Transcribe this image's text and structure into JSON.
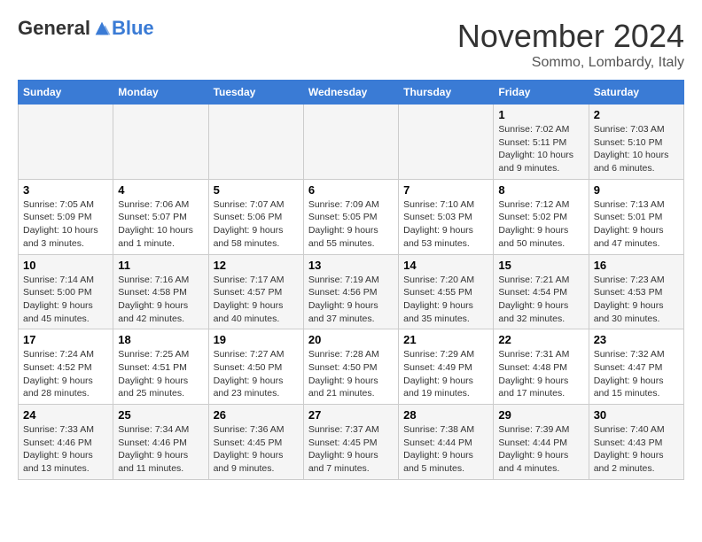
{
  "header": {
    "logo_line1": "General",
    "logo_line2": "Blue",
    "month_title": "November 2024",
    "location": "Sommo, Lombardy, Italy"
  },
  "weekdays": [
    "Sunday",
    "Monday",
    "Tuesday",
    "Wednesday",
    "Thursday",
    "Friday",
    "Saturday"
  ],
  "weeks": [
    [
      {
        "day": "",
        "info": ""
      },
      {
        "day": "",
        "info": ""
      },
      {
        "day": "",
        "info": ""
      },
      {
        "day": "",
        "info": ""
      },
      {
        "day": "",
        "info": ""
      },
      {
        "day": "1",
        "info": "Sunrise: 7:02 AM\nSunset: 5:11 PM\nDaylight: 10 hours and 9 minutes."
      },
      {
        "day": "2",
        "info": "Sunrise: 7:03 AM\nSunset: 5:10 PM\nDaylight: 10 hours and 6 minutes."
      }
    ],
    [
      {
        "day": "3",
        "info": "Sunrise: 7:05 AM\nSunset: 5:09 PM\nDaylight: 10 hours and 3 minutes."
      },
      {
        "day": "4",
        "info": "Sunrise: 7:06 AM\nSunset: 5:07 PM\nDaylight: 10 hours and 1 minute."
      },
      {
        "day": "5",
        "info": "Sunrise: 7:07 AM\nSunset: 5:06 PM\nDaylight: 9 hours and 58 minutes."
      },
      {
        "day": "6",
        "info": "Sunrise: 7:09 AM\nSunset: 5:05 PM\nDaylight: 9 hours and 55 minutes."
      },
      {
        "day": "7",
        "info": "Sunrise: 7:10 AM\nSunset: 5:03 PM\nDaylight: 9 hours and 53 minutes."
      },
      {
        "day": "8",
        "info": "Sunrise: 7:12 AM\nSunset: 5:02 PM\nDaylight: 9 hours and 50 minutes."
      },
      {
        "day": "9",
        "info": "Sunrise: 7:13 AM\nSunset: 5:01 PM\nDaylight: 9 hours and 47 minutes."
      }
    ],
    [
      {
        "day": "10",
        "info": "Sunrise: 7:14 AM\nSunset: 5:00 PM\nDaylight: 9 hours and 45 minutes."
      },
      {
        "day": "11",
        "info": "Sunrise: 7:16 AM\nSunset: 4:58 PM\nDaylight: 9 hours and 42 minutes."
      },
      {
        "day": "12",
        "info": "Sunrise: 7:17 AM\nSunset: 4:57 PM\nDaylight: 9 hours and 40 minutes."
      },
      {
        "day": "13",
        "info": "Sunrise: 7:19 AM\nSunset: 4:56 PM\nDaylight: 9 hours and 37 minutes."
      },
      {
        "day": "14",
        "info": "Sunrise: 7:20 AM\nSunset: 4:55 PM\nDaylight: 9 hours and 35 minutes."
      },
      {
        "day": "15",
        "info": "Sunrise: 7:21 AM\nSunset: 4:54 PM\nDaylight: 9 hours and 32 minutes."
      },
      {
        "day": "16",
        "info": "Sunrise: 7:23 AM\nSunset: 4:53 PM\nDaylight: 9 hours and 30 minutes."
      }
    ],
    [
      {
        "day": "17",
        "info": "Sunrise: 7:24 AM\nSunset: 4:52 PM\nDaylight: 9 hours and 28 minutes."
      },
      {
        "day": "18",
        "info": "Sunrise: 7:25 AM\nSunset: 4:51 PM\nDaylight: 9 hours and 25 minutes."
      },
      {
        "day": "19",
        "info": "Sunrise: 7:27 AM\nSunset: 4:50 PM\nDaylight: 9 hours and 23 minutes."
      },
      {
        "day": "20",
        "info": "Sunrise: 7:28 AM\nSunset: 4:50 PM\nDaylight: 9 hours and 21 minutes."
      },
      {
        "day": "21",
        "info": "Sunrise: 7:29 AM\nSunset: 4:49 PM\nDaylight: 9 hours and 19 minutes."
      },
      {
        "day": "22",
        "info": "Sunrise: 7:31 AM\nSunset: 4:48 PM\nDaylight: 9 hours and 17 minutes."
      },
      {
        "day": "23",
        "info": "Sunrise: 7:32 AM\nSunset: 4:47 PM\nDaylight: 9 hours and 15 minutes."
      }
    ],
    [
      {
        "day": "24",
        "info": "Sunrise: 7:33 AM\nSunset: 4:46 PM\nDaylight: 9 hours and 13 minutes."
      },
      {
        "day": "25",
        "info": "Sunrise: 7:34 AM\nSunset: 4:46 PM\nDaylight: 9 hours and 11 minutes."
      },
      {
        "day": "26",
        "info": "Sunrise: 7:36 AM\nSunset: 4:45 PM\nDaylight: 9 hours and 9 minutes."
      },
      {
        "day": "27",
        "info": "Sunrise: 7:37 AM\nSunset: 4:45 PM\nDaylight: 9 hours and 7 minutes."
      },
      {
        "day": "28",
        "info": "Sunrise: 7:38 AM\nSunset: 4:44 PM\nDaylight: 9 hours and 5 minutes."
      },
      {
        "day": "29",
        "info": "Sunrise: 7:39 AM\nSunset: 4:44 PM\nDaylight: 9 hours and 4 minutes."
      },
      {
        "day": "30",
        "info": "Sunrise: 7:40 AM\nSunset: 4:43 PM\nDaylight: 9 hours and 2 minutes."
      }
    ]
  ]
}
